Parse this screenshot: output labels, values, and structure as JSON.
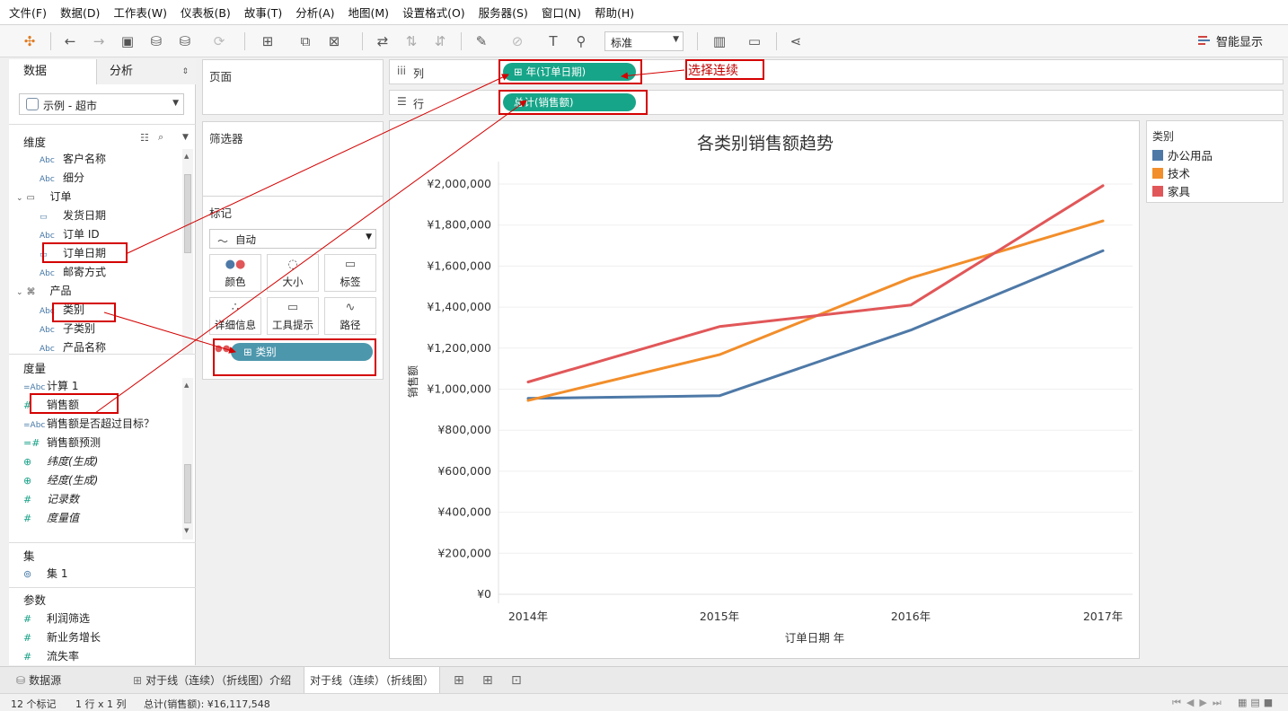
{
  "menu": [
    "文件(F)",
    "数据(D)",
    "工作表(W)",
    "仪表板(B)",
    "故事(T)",
    "分析(A)",
    "地图(M)",
    "设置格式(O)",
    "服务器(S)",
    "窗口(N)",
    "帮助(H)"
  ],
  "toolbar": {
    "fit_value": "标准",
    "show_me": "智能显示"
  },
  "datapane": {
    "tab_data": "数据",
    "tab_analysis": "分析",
    "datasource": "示例 - 超市",
    "dimensions_label": "维度",
    "dimensions": [
      {
        "type": "Abc",
        "label": "客户名称"
      },
      {
        "type": "Abc",
        "label": "细分"
      },
      {
        "type": "folder",
        "label": "订单"
      },
      {
        "type": "date",
        "label": "发货日期"
      },
      {
        "type": "Abc",
        "label": "订单 ID"
      },
      {
        "type": "date",
        "label": "订单日期"
      },
      {
        "type": "Abc",
        "label": "邮寄方式"
      },
      {
        "type": "hier",
        "label": "产品"
      },
      {
        "type": "Abc",
        "label": "类别"
      },
      {
        "type": "Abc",
        "label": "子类别"
      },
      {
        "type": "Abc",
        "label": "产品名称"
      }
    ],
    "measures_label": "度量",
    "measures": [
      {
        "type": "=Abc",
        "label": "计算 1"
      },
      {
        "type": "#",
        "label": "销售额"
      },
      {
        "type": "=Abc",
        "label": "销售额是否超过目标？"
      },
      {
        "type": "=#",
        "label": "销售额预测"
      },
      {
        "type": "globe",
        "label": "纬度(生成)"
      },
      {
        "type": "globe",
        "label": "经度(生成)"
      },
      {
        "type": "#",
        "label": "记录数"
      },
      {
        "type": "#",
        "label": "度量值"
      }
    ],
    "sets_label": "集",
    "sets": [
      {
        "label": "集 1"
      }
    ],
    "params_label": "参数",
    "params": [
      {
        "label": "利润筛选"
      },
      {
        "label": "新业务增长"
      },
      {
        "label": "流失率"
      }
    ]
  },
  "cards": {
    "pages": "页面",
    "filters": "筛选器",
    "marks": "标记",
    "mark_type": "自动",
    "buttons": [
      "颜色",
      "大小",
      "标签",
      "详细信息",
      "工具提示",
      "路径"
    ],
    "color_pill": "类别"
  },
  "shelves": {
    "columns_label": "列",
    "rows_label": "行",
    "columns_pill": "年(订单日期)",
    "rows_pill": "总计(销售额)"
  },
  "annotation": "选择连续",
  "legend": {
    "title": "类别",
    "items": [
      {
        "label": "办公用品",
        "color": "#4e79a7"
      },
      {
        "label": "技术",
        "color": "#f28e2b"
      },
      {
        "label": "家具",
        "color": "#e15759"
      }
    ]
  },
  "chart_data": {
    "type": "line",
    "title": "各类别销售额趋势",
    "xlabel": "订单日期 年",
    "ylabel": "销售额",
    "categories": [
      "2014年",
      "2015年",
      "2016年",
      "2017年"
    ],
    "yticks": [
      "¥0",
      "¥200,000",
      "¥400,000",
      "¥600,000",
      "¥800,000",
      "¥1,000,000",
      "¥1,200,000",
      "¥1,400,000",
      "¥1,600,000",
      "¥1,800,000",
      "¥2,000,000"
    ],
    "ylim": [
      0,
      2000000
    ],
    "series": [
      {
        "name": "办公用品",
        "color": "#4e79a7",
        "values": [
          955000,
          968000,
          1288000,
          1675000
        ]
      },
      {
        "name": "技术",
        "color": "#f28e2b",
        "values": [
          945000,
          1168000,
          1542000,
          1820000
        ]
      },
      {
        "name": "家具",
        "color": "#e15759",
        "values": [
          1035000,
          1305000,
          1410000,
          1992000
        ]
      }
    ]
  },
  "sheets": {
    "datasource_tab": "数据源",
    "tab1": "对于线（连续）（折线图）介绍",
    "tab2": "对于线（连续）（折线图）"
  },
  "status": {
    "marks": "12 个标记",
    "dims": "1 行 x 1 列",
    "total": "总计(销售额): ¥16,117,548"
  }
}
